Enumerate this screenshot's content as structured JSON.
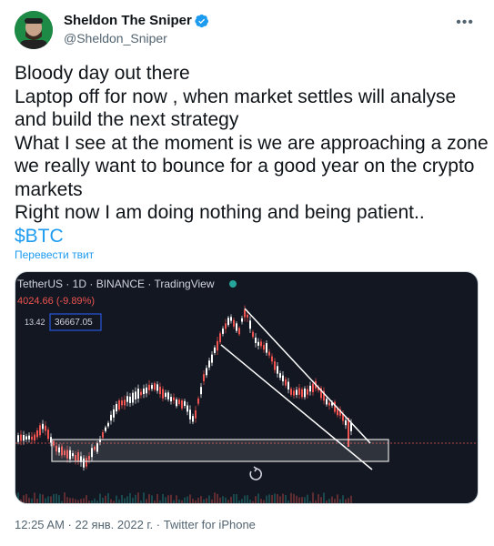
{
  "author": {
    "name": "Sheldon The Sniper",
    "handle": "@Sheldon_Sniper",
    "verified": true,
    "avatar_icon": "avatar-icon"
  },
  "tweet": {
    "lines": [
      "Bloody day out there",
      "Laptop off for now , when market settles will analyse",
      "and build the next strategy",
      "What I see at the moment is we are approaching a zone",
      "we really want to bounce for a good year on the crypto",
      "markets",
      "Right now I am doing nothing and being patient.."
    ],
    "cashtag": "$BTC",
    "translate_label": "Перевести твит"
  },
  "chart": {
    "header": "TetherUS · 1D · BINANCE · TradingView",
    "change": "4024.66 (-9.89%)",
    "price_left": "13.42",
    "price_box": "36667.05",
    "reset_icon": "rotate-icon",
    "colors": {
      "background": "#131722",
      "up": "#ffffff",
      "down": "#ef5350",
      "zone": "#ffffff"
    }
  },
  "meta": {
    "text": "12:25 AM · 22 янв. 2022 г. · Twitter for iPhone"
  }
}
